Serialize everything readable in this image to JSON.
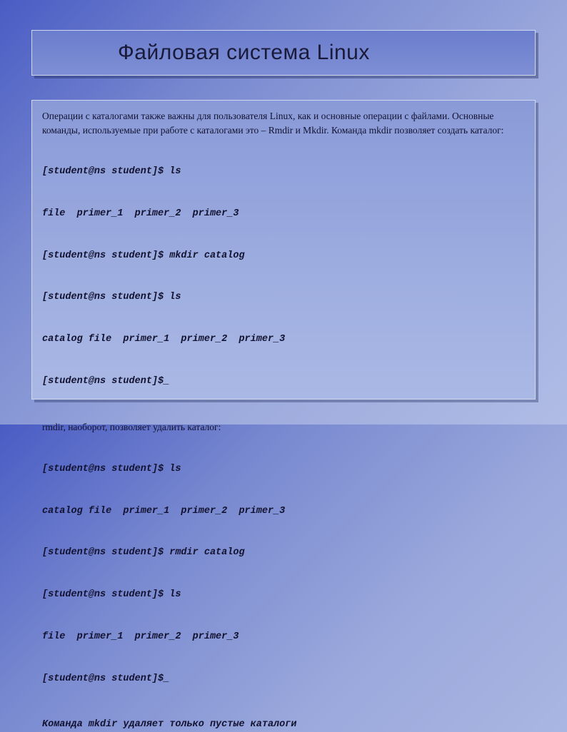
{
  "slide": {
    "title": "Файловая система Linux",
    "intro": "Операции с каталогами также важны для пользователя Linux, как и основные операции с файлами. Основные команды, используемые при работе с каталогами это – Rmdir и Mkdir. Команда mkdir позволяет создать каталог:",
    "term1_lines": [
      "[student@ns student]$ ls",
      "file  primer_1  primer_2  primer_3",
      "[student@ns student]$ mkdir catalog",
      "[student@ns student]$ ls",
      "catalog file  primer_1  primer_2  primer_3",
      "[student@ns student]$_"
    ],
    "mid": "rmdir, наоборот, позволяет удалить каталог:",
    "term2_lines": [
      "[student@ns student]$ ls",
      "catalog file  primer_1  primer_2  primer_3",
      "[student@ns student]$ rmdir catalog",
      "[student@ns student]$ ls",
      "file  primer_1  primer_2  primer_3",
      "[student@ns student]$_"
    ],
    "footer": "Команда mkdir удаляет только пустые каталоги"
  }
}
